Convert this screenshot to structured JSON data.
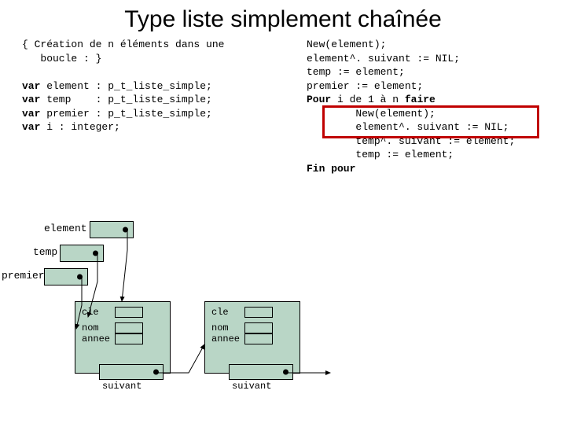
{
  "title": "Type liste simplement chaînée",
  "left": {
    "comment_open": "{ Création de n éléments dans une",
    "comment_close": "   boucle : }",
    "var1": "var",
    "var1_rest": " element : p_t_liste_simple;",
    "var2": "var",
    "var2_rest": " temp    : p_t_liste_simple;",
    "var3": "var",
    "var3_rest": " premier : p_t_liste_simple;",
    "var4": "var",
    "var4_rest": " i : integer;"
  },
  "right": {
    "l1": "New(element);",
    "l2": "element^. suivant := NIL;",
    "l3": "temp := element;",
    "l4": "premier := element;",
    "l5a": "Pour",
    "l5b": " i de 1 à n ",
    "l5c": "faire",
    "l6": "        New(element);",
    "l7": "        element^. suivant := NIL;",
    "l8": "        temp^. suivant := element;",
    "l9": "        temp := element;",
    "l10": "Fin pour"
  },
  "diagram": {
    "labels": {
      "element": "element",
      "temp": "temp",
      "premier": "premier"
    },
    "node": {
      "cle": "cle",
      "nom": "nom",
      "annee": "annee",
      "suivant": "suivant"
    }
  }
}
